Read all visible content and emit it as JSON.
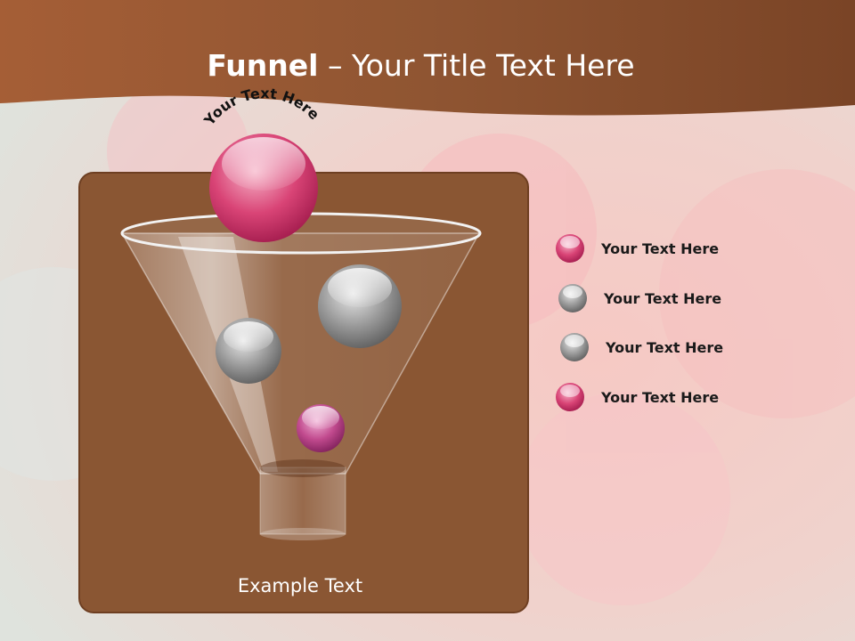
{
  "title": {
    "bold": "Funnel",
    "rest": " – Your Title Text Here"
  },
  "funnel": {
    "arc_label": "Your Text Here",
    "caption": "Example Text"
  },
  "legend": [
    {
      "label": "Your  Text Here",
      "color": "#c8447a"
    },
    {
      "label": "Your  Text Here",
      "color": "#8c8c8c"
    },
    {
      "label": "Your  Text Here",
      "color": "#8c8c8c"
    },
    {
      "label": "Your  Text Here",
      "color": "#d03a6a"
    }
  ],
  "colors": {
    "header_brown": "#8b4f2d",
    "panel_brown": "#8a5633",
    "accent_pink": "#d93a6e"
  }
}
